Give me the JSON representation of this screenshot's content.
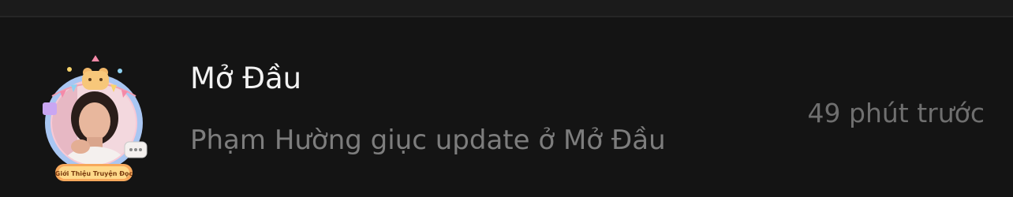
{
  "notification": {
    "title": "Mở Đầu",
    "message": "Phạm Hường giục update ở Mở Đầu",
    "time": "49 phút trước",
    "avatar": {
      "icon": "user-avatar-with-decorative-frame",
      "frame_badge_text": "Giới Thiệu Truyện Đọc"
    }
  },
  "colors": {
    "background": "#141414",
    "title": "#f2f2f2",
    "message": "#7d7d7d",
    "time": "#6f6f6f"
  }
}
